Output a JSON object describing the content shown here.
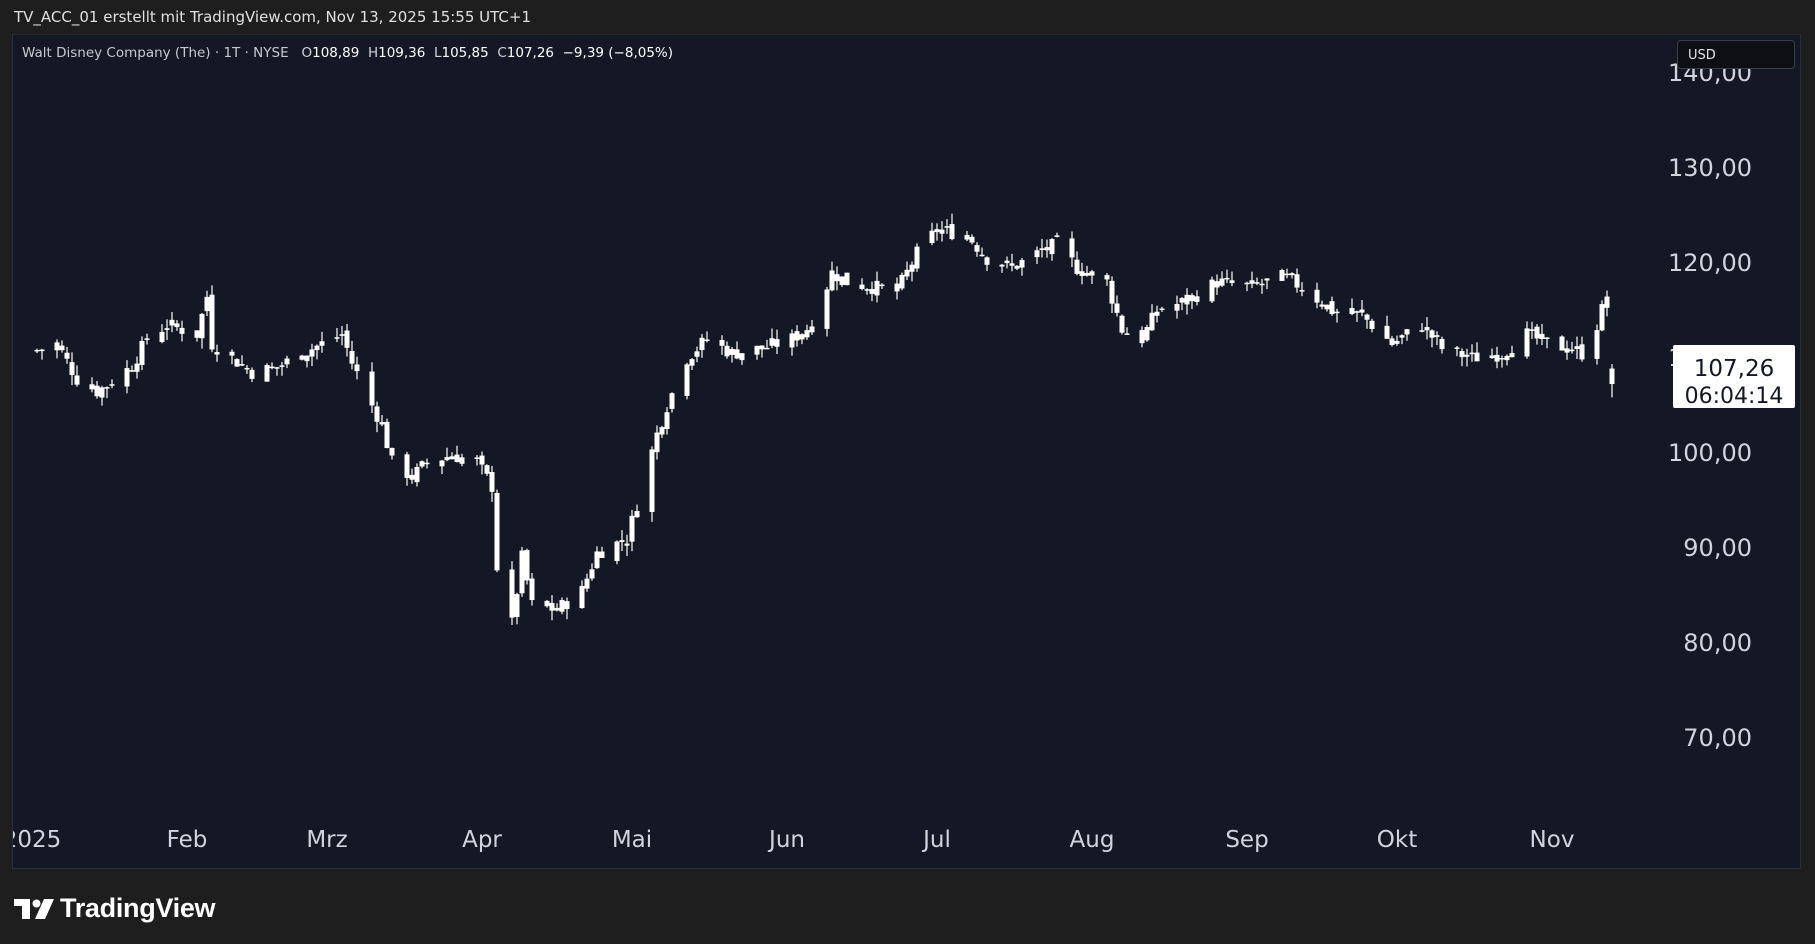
{
  "header": {
    "caption": "TV_ACC_01 erstellt mit TradingView.com, Nov 13, 2025 15:55 UTC+1"
  },
  "legend": {
    "symbol": "Walt Disney Company (The) · 1T · NYSE",
    "open_label": "O",
    "open": "108,89",
    "high_label": "H",
    "high": "109,36",
    "low_label": "L",
    "low": "105,85",
    "close_label": "C",
    "close": "107,26",
    "change": "−9,39 (−8,05%)"
  },
  "currency": "USD",
  "price_label": {
    "price": "107,26",
    "countdown": "06:04:14"
  },
  "brand": "TradingView",
  "colors": {
    "background": "#141824",
    "candle": "#ffffff",
    "text": "#d1d4dc"
  },
  "chart_data": {
    "type": "candlestick",
    "title": "Walt Disney Company (The) · 1T · NYSE",
    "ylim": [
      60,
      140
    ],
    "y_ticks": [
      "140,00",
      "130,00",
      "120,00",
      "110,00",
      "100,00",
      "90,00",
      "80,00",
      "70,00"
    ],
    "x_ticks": [
      {
        "label": "2025",
        "date": "2025-01-01"
      },
      {
        "label": "Feb",
        "date": "2025-02-01"
      },
      {
        "label": "Mrz",
        "date": "2025-03-01"
      },
      {
        "label": "Apr",
        "date": "2025-04-01"
      },
      {
        "label": "Mai",
        "date": "2025-05-01"
      },
      {
        "label": "Jun",
        "date": "2025-06-01"
      },
      {
        "label": "Jul",
        "date": "2025-07-01"
      },
      {
        "label": "Aug",
        "date": "2025-08-01"
      },
      {
        "label": "Sep",
        "date": "2025-09-01"
      },
      {
        "label": "Okt",
        "date": "2025-10-01"
      },
      {
        "label": "Nov",
        "date": "2025-11-01"
      }
    ],
    "last_price": 107.26,
    "close_path": [
      [
        "2025-01-02",
        110.8
      ],
      [
        "2025-01-06",
        111.5
      ],
      [
        "2025-01-10",
        107.8
      ],
      [
        "2025-01-14",
        106.5
      ],
      [
        "2025-01-17",
        107.5
      ],
      [
        "2025-01-21",
        109.2
      ],
      [
        "2025-01-24",
        112.0
      ],
      [
        "2025-01-28",
        113.5
      ],
      [
        "2025-02-03",
        112.5
      ],
      [
        "2025-02-05",
        116.5
      ],
      [
        "2025-02-06",
        111.5
      ],
      [
        "2025-02-10",
        110.0
      ],
      [
        "2025-02-14",
        108.5
      ],
      [
        "2025-02-19",
        109.0
      ],
      [
        "2025-02-24",
        110.5
      ],
      [
        "2025-02-28",
        111.5
      ],
      [
        "2025-03-04",
        112.5
      ],
      [
        "2025-03-06",
        109.5
      ],
      [
        "2025-03-10",
        105.0
      ],
      [
        "2025-03-12",
        103.0
      ],
      [
        "2025-03-14",
        99.0
      ],
      [
        "2025-03-18",
        97.5
      ],
      [
        "2025-03-21",
        99.0
      ],
      [
        "2025-03-26",
        99.8
      ],
      [
        "2025-03-31",
        99.0
      ],
      [
        "2025-04-03",
        96.5
      ],
      [
        "2025-04-04",
        88.0
      ],
      [
        "2025-04-07",
        82.0
      ],
      [
        "2025-04-09",
        89.0
      ],
      [
        "2025-04-11",
        84.0
      ],
      [
        "2025-04-16",
        83.5
      ],
      [
        "2025-04-21",
        85.5
      ],
      [
        "2025-04-24",
        89.5
      ],
      [
        "2025-04-28",
        90.5
      ],
      [
        "2025-04-30",
        91.0
      ],
      [
        "2025-05-06",
        102.0
      ],
      [
        "2025-05-08",
        105.0
      ],
      [
        "2025-05-12",
        110.0
      ],
      [
        "2025-05-16",
        112.0
      ],
      [
        "2025-05-21",
        110.5
      ],
      [
        "2025-05-27",
        111.0
      ],
      [
        "2025-06-02",
        112.0
      ],
      [
        "2025-06-06",
        113.5
      ],
      [
        "2025-06-10",
        119.0
      ],
      [
        "2025-06-13",
        118.0
      ],
      [
        "2025-06-18",
        117.5
      ],
      [
        "2025-06-23",
        117.0
      ],
      [
        "2025-06-27",
        121.0
      ],
      [
        "2025-07-01",
        123.5
      ],
      [
        "2025-07-07",
        123.0
      ],
      [
        "2025-07-11",
        120.5
      ],
      [
        "2025-07-16",
        119.5
      ],
      [
        "2025-07-21",
        121.0
      ],
      [
        "2025-07-25",
        122.0
      ],
      [
        "2025-07-29",
        119.5
      ],
      [
        "2025-08-04",
        118.0
      ],
      [
        "2025-08-07",
        113.0
      ],
      [
        "2025-08-11",
        112.0
      ],
      [
        "2025-08-14",
        115.0
      ],
      [
        "2025-08-20",
        116.0
      ],
      [
        "2025-08-26",
        118.0
      ],
      [
        "2025-09-02",
        117.5
      ],
      [
        "2025-09-08",
        118.5
      ],
      [
        "2025-09-12",
        117.5
      ],
      [
        "2025-09-18",
        115.0
      ],
      [
        "2025-09-24",
        114.5
      ],
      [
        "2025-09-30",
        111.5
      ],
      [
        "2025-10-06",
        113.5
      ],
      [
        "2025-10-10",
        111.0
      ],
      [
        "2025-10-16",
        110.0
      ],
      [
        "2025-10-22",
        110.5
      ],
      [
        "2025-10-27",
        112.5
      ],
      [
        "2025-10-31",
        111.5
      ],
      [
        "2025-11-05",
        111.0
      ],
      [
        "2025-11-07",
        110.5
      ],
      [
        "2025-11-10",
        113.5
      ],
      [
        "2025-11-12",
        116.6
      ],
      [
        "2025-11-13",
        107.26
      ]
    ]
  }
}
